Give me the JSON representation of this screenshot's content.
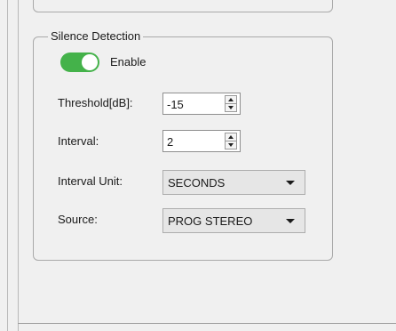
{
  "group": {
    "title": "Silence Detection"
  },
  "enable": {
    "label": "Enable",
    "state": "on",
    "color": "#44b24a"
  },
  "threshold": {
    "label": "Threshold[dB]:",
    "value": "-15"
  },
  "interval": {
    "label": "Interval:",
    "value": "2"
  },
  "interval_unit": {
    "label": "Interval Unit:",
    "value": "SECONDS"
  },
  "source": {
    "label": "Source:",
    "value": "PROG STEREO"
  }
}
